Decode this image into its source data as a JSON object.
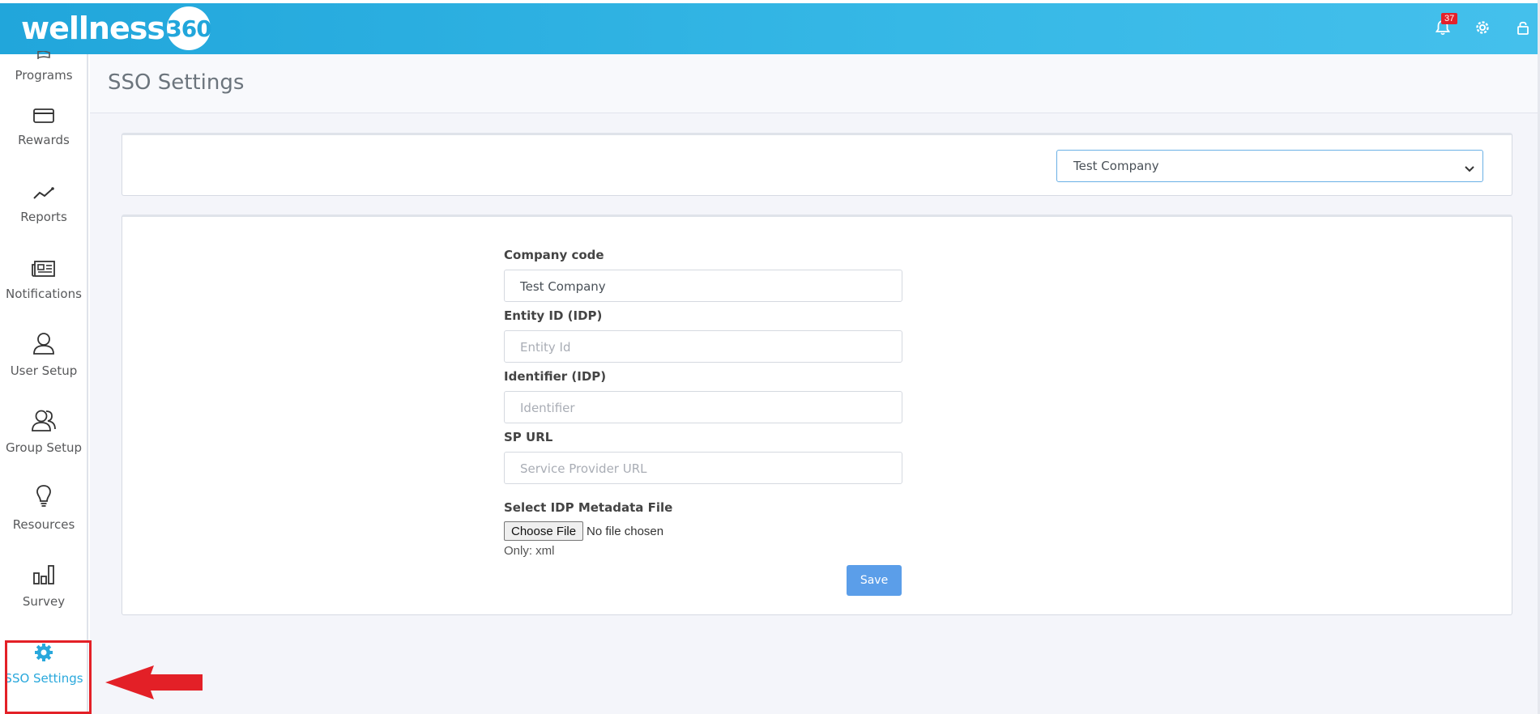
{
  "header": {
    "logo_text": "wellness",
    "logo_badge": "360",
    "notification_count": "37",
    "icons": [
      "bell-icon",
      "gear-icon",
      "lock-icon"
    ]
  },
  "sidebar": {
    "items": [
      {
        "label": "Programs",
        "icon": "flag-icon"
      },
      {
        "label": "Rewards",
        "icon": "card-icon"
      },
      {
        "label": "Reports",
        "icon": "trend-line-icon"
      },
      {
        "label": "Notifications",
        "icon": "newspaper-icon"
      },
      {
        "label": "User Setup",
        "icon": "user-icon"
      },
      {
        "label": "Group Setup",
        "icon": "group-icon"
      },
      {
        "label": "Resources",
        "icon": "lightbulb-icon"
      },
      {
        "label": "Survey",
        "icon": "bar-chart-icon"
      },
      {
        "label": "SSO Settings",
        "icon": "gear-icon",
        "active": true
      }
    ]
  },
  "page": {
    "title": "SSO Settings"
  },
  "company_select": {
    "selected": "Test Company"
  },
  "form": {
    "company_code": {
      "label": "Company code",
      "value": "Test Company"
    },
    "entity_id": {
      "label": "Entity ID (IDP)",
      "placeholder": "Entity Id"
    },
    "identifier": {
      "label": "Identifier (IDP)",
      "placeholder": "Identifier"
    },
    "sp_url": {
      "label": "SP URL",
      "placeholder": "Service Provider URL"
    },
    "metadata_file": {
      "label": "Select IDP Metadata File",
      "button": "Choose File",
      "status": "No file chosen",
      "hint": "Only: xml"
    },
    "save_label": "Save"
  },
  "colors": {
    "header": "#21a6db",
    "accent": "#29a8dc",
    "save_button": "#5b9ee9",
    "highlight": "#e32027"
  }
}
